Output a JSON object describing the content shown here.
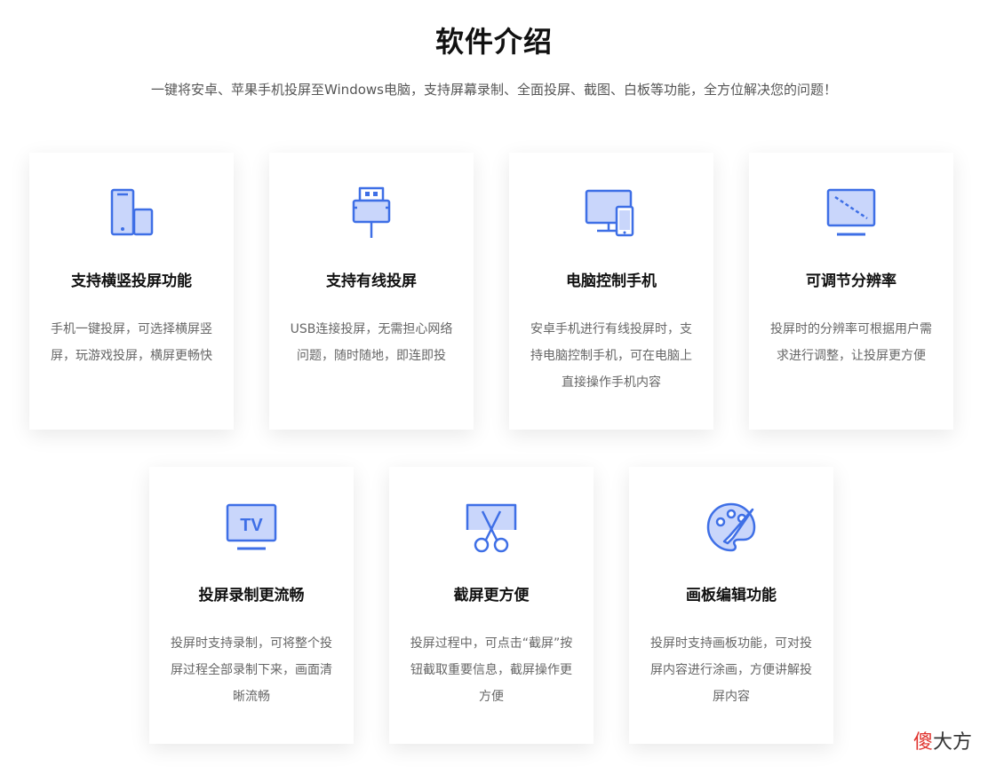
{
  "header": {
    "title": "软件介绍",
    "subtitle": "一键将安卓、苹果手机投屏至Windows电脑，支持屏幕录制、全面投屏、截图、白板等功能，全方位解决您的问题！"
  },
  "colors": {
    "accent": "#3e6fe6",
    "icon_fill": "#c9d6fb"
  },
  "cards": [
    {
      "icon": "phone-rotate-icon",
      "title": "支持横竖投屏功能",
      "desc": "手机一键投屏，可选择横屏竖屏，玩游戏投屏，横屏更畅快"
    },
    {
      "icon": "usb-plug-icon",
      "title": "支持有线投屏",
      "desc": "USB连接投屏，无需担心网络问题，随时随地，即连即投"
    },
    {
      "icon": "monitor-phone-icon",
      "title": "电脑控制手机",
      "desc": "安卓手机进行有线投屏时，支持电脑控制手机，可在电脑上直接操作手机内容"
    },
    {
      "icon": "resolution-monitor-icon",
      "title": "可调节分辨率",
      "desc": "投屏时的分辨率可根据用户需求进行调整，让投屏更方便"
    },
    {
      "icon": "tv-icon",
      "title": "投屏录制更流畅",
      "desc": "投屏时支持录制，可将整个投屏过程全部录制下来，画面清晰流畅"
    },
    {
      "icon": "scissors-screen-icon",
      "title": "截屏更方便",
      "desc": "投屏过程中，可点击“截屏”按钮截取重要信息，截屏操作更方便"
    },
    {
      "icon": "palette-icon",
      "title": "画板编辑功能",
      "desc": "投屏时支持画板功能，可对投屏内容进行涂画，方便讲解投屏内容"
    }
  ],
  "tv_icon_text": "TV",
  "watermark": {
    "red": "傻",
    "rest": "大方"
  }
}
